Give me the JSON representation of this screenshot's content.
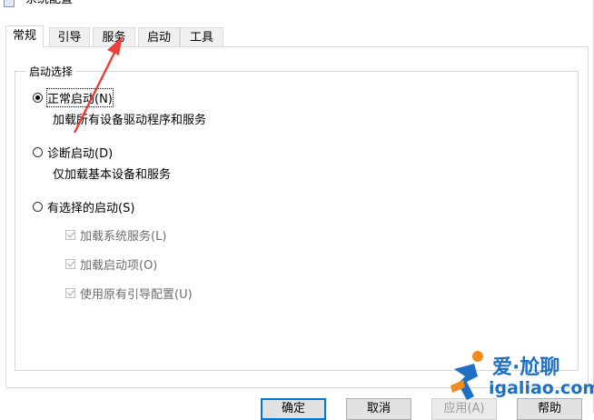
{
  "window": {
    "title": "系统配置"
  },
  "tabs": [
    {
      "label": "常规",
      "active": true
    },
    {
      "label": "引导",
      "active": false
    },
    {
      "label": "服务",
      "active": false
    },
    {
      "label": "启动",
      "active": false
    },
    {
      "label": "工具",
      "active": false
    }
  ],
  "startup_group": {
    "legend": "启动选择",
    "normal": {
      "label": "正常启动(N)",
      "desc": "加载所有设备驱动程序和服务",
      "selected": true
    },
    "diagnostic": {
      "label": "诊断启动(D)",
      "desc": "仅加载基本设备和服务",
      "selected": false
    },
    "selective": {
      "label": "有选择的启动(S)",
      "selected": false,
      "options": [
        {
          "label": "加载系统服务(L)",
          "checked": true,
          "enabled": false
        },
        {
          "label": "加载启动项(O)",
          "checked": true,
          "enabled": false
        },
        {
          "label": "使用原有引导配置(U)",
          "checked": true,
          "enabled": false
        }
      ]
    }
  },
  "buttons": {
    "ok": "确定",
    "cancel": "取消",
    "apply": "应用(A)",
    "help": "帮助"
  },
  "watermark": {
    "line1": "爱·尬聊",
    "line2": "igaliao.com"
  },
  "colors": {
    "arrow": "#e8413b",
    "focus": "#0078d7",
    "brand": "#1f6fc2"
  }
}
